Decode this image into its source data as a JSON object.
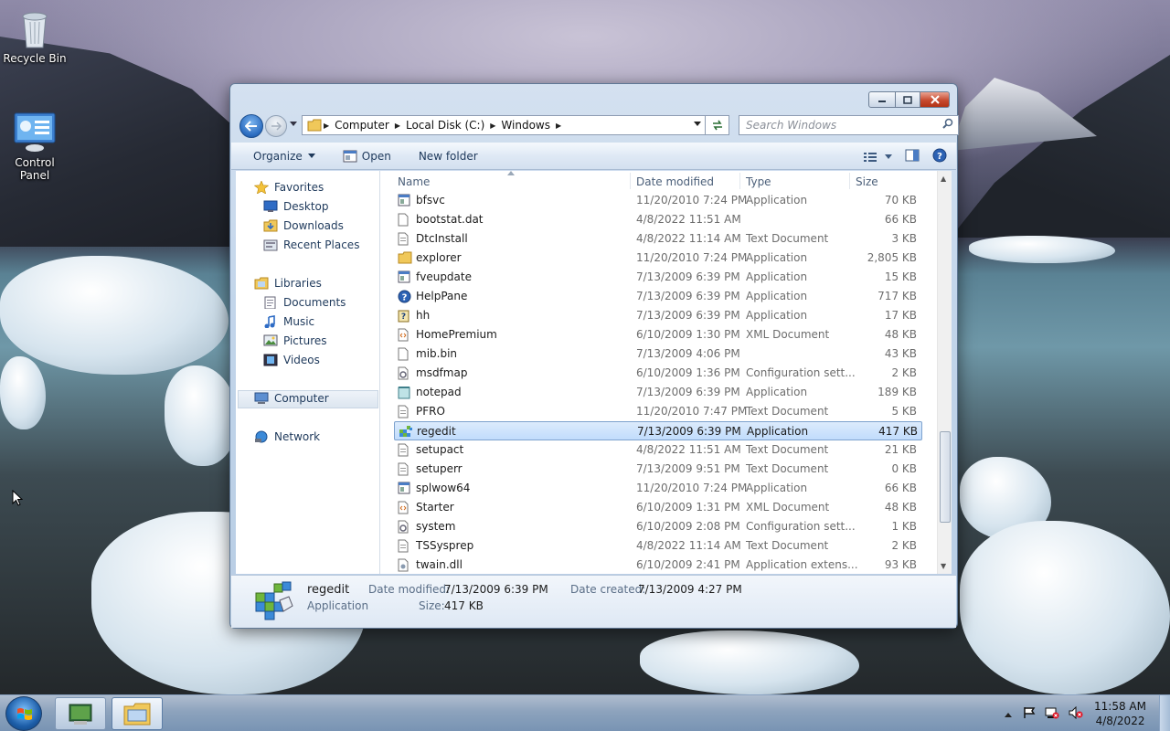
{
  "desktop": {
    "icons": [
      {
        "label": "Recycle Bin"
      },
      {
        "label": "Control Panel"
      }
    ]
  },
  "window": {
    "address": {
      "crumbs": [
        "Computer",
        "Local Disk (C:)",
        "Windows"
      ]
    },
    "search_placeholder": "Search Windows",
    "toolbar": {
      "organize": "Organize",
      "open": "Open",
      "new_folder": "New folder"
    },
    "nav_pane": {
      "favorites": "Favorites",
      "desktop": "Desktop",
      "downloads": "Downloads",
      "recent_places": "Recent Places",
      "libraries": "Libraries",
      "documents": "Documents",
      "music": "Music",
      "pictures": "Pictures",
      "videos": "Videos",
      "computer": "Computer",
      "network": "Network"
    },
    "columns": {
      "name": "Name",
      "date_modified": "Date modified",
      "type": "Type",
      "size": "Size"
    },
    "files": [
      {
        "name": "bfsvc",
        "modified": "11/20/2010 7:24 PM",
        "type": "Application",
        "size": "70 KB",
        "icon": "app-icon"
      },
      {
        "name": "bootstat.dat",
        "modified": "4/8/2022 11:51 AM",
        "type": "",
        "size": "66 KB",
        "icon": "blank-file-icon"
      },
      {
        "name": "DtcInstall",
        "modified": "4/8/2022 11:14 AM",
        "type": "Text Document",
        "size": "3 KB",
        "icon": "text-file-icon"
      },
      {
        "name": "explorer",
        "modified": "11/20/2010 7:24 PM",
        "type": "Application",
        "size": "2,805 KB",
        "icon": "folder-app-icon"
      },
      {
        "name": "fveupdate",
        "modified": "7/13/2009 6:39 PM",
        "type": "Application",
        "size": "15 KB",
        "icon": "app-icon"
      },
      {
        "name": "HelpPane",
        "modified": "7/13/2009 6:39 PM",
        "type": "Application",
        "size": "717 KB",
        "icon": "help-icon"
      },
      {
        "name": "hh",
        "modified": "7/13/2009 6:39 PM",
        "type": "Application",
        "size": "17 KB",
        "icon": "help-book-icon"
      },
      {
        "name": "HomePremium",
        "modified": "6/10/2009 1:30 PM",
        "type": "XML Document",
        "size": "48 KB",
        "icon": "xml-file-icon"
      },
      {
        "name": "mib.bin",
        "modified": "7/13/2009 4:06 PM",
        "type": "",
        "size": "43 KB",
        "icon": "blank-file-icon"
      },
      {
        "name": "msdfmap",
        "modified": "6/10/2009 1:36 PM",
        "type": "Configuration sett...",
        "size": "2 KB",
        "icon": "config-file-icon"
      },
      {
        "name": "notepad",
        "modified": "7/13/2009 6:39 PM",
        "type": "Application",
        "size": "189 KB",
        "icon": "notepad-icon"
      },
      {
        "name": "PFRO",
        "modified": "11/20/2010 7:47 PM",
        "type": "Text Document",
        "size": "5 KB",
        "icon": "text-file-icon"
      },
      {
        "name": "regedit",
        "modified": "7/13/2009 6:39 PM",
        "type": "Application",
        "size": "417 KB",
        "icon": "regedit-icon"
      },
      {
        "name": "setupact",
        "modified": "4/8/2022 11:51 AM",
        "type": "Text Document",
        "size": "21 KB",
        "icon": "text-file-icon"
      },
      {
        "name": "setuperr",
        "modified": "7/13/2009 9:51 PM",
        "type": "Text Document",
        "size": "0 KB",
        "icon": "text-file-icon"
      },
      {
        "name": "splwow64",
        "modified": "11/20/2010 7:24 PM",
        "type": "Application",
        "size": "66 KB",
        "icon": "app-icon"
      },
      {
        "name": "Starter",
        "modified": "6/10/2009 1:31 PM",
        "type": "XML Document",
        "size": "48 KB",
        "icon": "xml-file-icon"
      },
      {
        "name": "system",
        "modified": "6/10/2009 2:08 PM",
        "type": "Configuration sett...",
        "size": "1 KB",
        "icon": "config-file-icon"
      },
      {
        "name": "TSSysprep",
        "modified": "4/8/2022 11:14 AM",
        "type": "Text Document",
        "size": "2 KB",
        "icon": "text-file-icon"
      },
      {
        "name": "twain.dll",
        "modified": "6/10/2009 2:41 PM",
        "type": "Application extens...",
        "size": "93 KB",
        "icon": "dll-file-icon"
      }
    ],
    "selected_index": 12,
    "details": {
      "name": "regedit",
      "kind": "Application",
      "date_modified_label": "Date modified:",
      "date_modified": "7/13/2009 6:39 PM",
      "date_created_label": "Date created:",
      "date_created": "7/13/2009 4:27 PM",
      "size_label": "Size:",
      "size": "417 KB"
    }
  },
  "taskbar": {
    "clock_time": "11:58 AM",
    "clock_date": "4/8/2022"
  },
  "colors": {
    "selection": "#c1dcfc",
    "accent": "#1e395b",
    "close": "#c74a2f"
  }
}
